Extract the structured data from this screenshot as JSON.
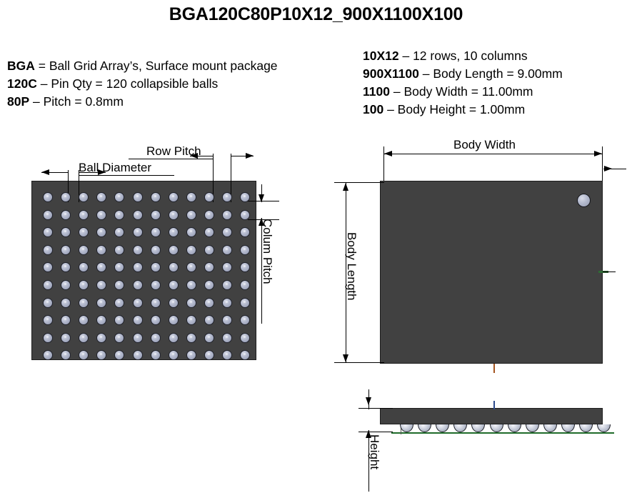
{
  "title": "BGA120C80P10X12_900X1100X100",
  "legend_left": [
    {
      "code": "BGA",
      "sep": " = ",
      "desc": "Ball Grid Array’s, Surface mount package"
    },
    {
      "code": "120C",
      "sep": " – ",
      "desc": "Pin Qty = 120 collapsible balls"
    },
    {
      "code": "80P",
      "sep": " – ",
      "desc": "Pitch = 0.8mm"
    }
  ],
  "legend_right": [
    {
      "code": "10X12",
      "sep": " – ",
      "desc": "12 rows, 10 columns"
    },
    {
      "code": "900X1100",
      "sep": " – ",
      "desc": "Body Length = 9.00mm"
    },
    {
      "code": "1100",
      "sep": " – ",
      "desc": "Body Width = 11.00mm"
    },
    {
      "code": "100",
      "sep": " – ",
      "desc": "Body Height = 1.00mm"
    }
  ],
  "dimensions": {
    "ball_diameter": "Ball Diameter",
    "row_pitch": "Row Pitch",
    "column_pitch": "Colum Pitch",
    "body_width": "Body Width",
    "body_length": "Body Length",
    "height": "Height"
  },
  "views": {
    "bottom_view": {
      "name": "ball-grid-bottom-view",
      "ball_columns": 12,
      "ball_rows": 10,
      "ball_count": 120
    },
    "front_view": {
      "name": "body-front-view",
      "pin1_marker": true
    },
    "side_view": {
      "name": "body-side-view",
      "ball_count": 12
    }
  },
  "colors": {
    "body": "#414141",
    "body_outline": "#1d1d1d",
    "ball": "#b3b9cd",
    "ball_outline": "#20222b",
    "ground_line": "#1f6b2a",
    "dimension_line": "#000000",
    "background": "#ffffff"
  },
  "chart_data": {
    "type": "table",
    "title": "BGA120C80P10X12_900X1100X100",
    "categories": [
      "Pin Qty",
      "Pitch",
      "Rows",
      "Columns",
      "Body Length",
      "Body Width",
      "Body Height"
    ],
    "values": [
      "120",
      "0.8mm",
      "12",
      "10",
      "9.00mm",
      "11.00mm",
      "1.00mm"
    ]
  }
}
